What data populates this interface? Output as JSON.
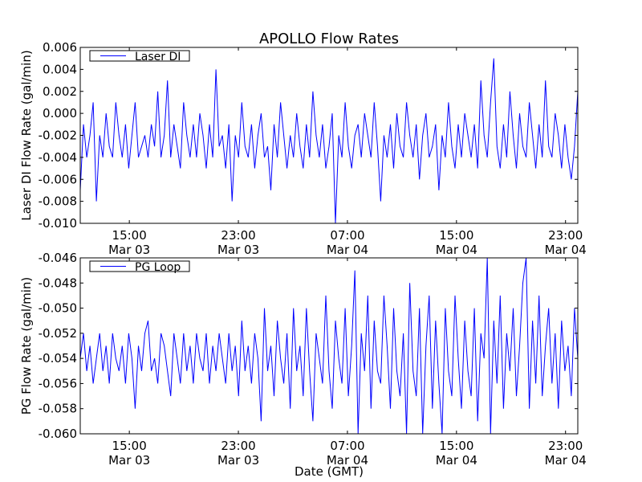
{
  "chart_data": [
    {
      "type": "line",
      "title": "APOLLO Flow Rates",
      "xlabel": "",
      "ylabel": "Laser DI Flow Rate (gal/min)",
      "ylim": [
        -0.01,
        0.006
      ],
      "yticks": [
        0.006,
        0.004,
        0.002,
        0.0,
        -0.002,
        -0.004,
        -0.006,
        -0.008,
        -0.01
      ],
      "ytick_labels": [
        "0.006",
        "0.004",
        "0.002",
        "0.000",
        "-0.002",
        "-0.004",
        "-0.006",
        "-0.008",
        "-0.010"
      ],
      "xlim_hours": [
        11.4,
        47.9
      ],
      "xticks_hours": [
        15,
        23,
        31,
        39,
        47
      ],
      "xtick_labels": [
        [
          "15:00",
          "Mar 03"
        ],
        [
          "23:00",
          "Mar 03"
        ],
        [
          "07:00",
          "Mar 04"
        ],
        [
          "15:00",
          "Mar 04"
        ],
        [
          "23:00",
          "Mar 04"
        ]
      ],
      "legend": {
        "label": "Laser DI",
        "placement": "top-left"
      },
      "series": [
        {
          "name": "Laser DI",
          "color": "#0000ff",
          "x_start_hours": 11.4,
          "x_step_hours": 0.237,
          "value_scale": 0.001,
          "values": [
            -7,
            -1,
            -4,
            -2,
            1,
            -8,
            -2,
            -4,
            0,
            -3,
            -4,
            1,
            -2,
            -4,
            -1,
            -5,
            -2,
            1,
            -4,
            -3,
            -2,
            -4,
            -1,
            -3,
            2,
            -4,
            -2,
            3,
            -4,
            -1,
            -3,
            -5,
            1,
            -2,
            -4,
            -1,
            -4,
            0,
            -2,
            -5,
            -1,
            -4,
            4,
            -3,
            -2,
            -5,
            -1,
            -8,
            -2,
            -4,
            1,
            -3,
            -4,
            -1,
            -5,
            -2,
            0,
            -4,
            -3,
            -7,
            -1,
            -4,
            1,
            -2,
            -5,
            -2,
            -4,
            0,
            -3,
            -5,
            -1,
            -4,
            2,
            -2,
            -4,
            -1,
            -5,
            -3,
            0,
            -10,
            -2,
            -4,
            1,
            -3,
            -5,
            -2,
            -1,
            -4,
            0,
            -2,
            -4,
            1,
            -3,
            -8,
            -2,
            -4,
            -1,
            -5,
            0,
            -3,
            -4,
            1,
            -2,
            -4,
            -1,
            -6,
            -2,
            0,
            -4,
            -3,
            -1,
            -7,
            -2,
            -4,
            1,
            -3,
            -5,
            -1,
            -4,
            0,
            -2,
            -4,
            -1,
            -5,
            3,
            -2,
            -4,
            1,
            5,
            -3,
            -5,
            -1,
            -4,
            2,
            -2,
            -5,
            0,
            -3,
            -4,
            1,
            -2,
            -5,
            -1,
            -4,
            3,
            -3,
            -4,
            0,
            -2,
            -5,
            -1,
            -4,
            -6,
            -3,
            2
          ]
        }
      ]
    },
    {
      "type": "line",
      "title": "",
      "xlabel": "Date (GMT)",
      "ylabel": "PG Flow Rate (gal/min)",
      "ylim": [
        -0.06,
        -0.046
      ],
      "yticks": [
        -0.046,
        -0.048,
        -0.05,
        -0.052,
        -0.054,
        -0.056,
        -0.058,
        -0.06
      ],
      "ytick_labels": [
        "-0.046",
        "-0.048",
        "-0.050",
        "-0.052",
        "-0.054",
        "-0.056",
        "-0.058",
        "-0.060"
      ],
      "xlim_hours": [
        11.4,
        47.9
      ],
      "xticks_hours": [
        15,
        23,
        31,
        39,
        47
      ],
      "xtick_labels": [
        [
          "15:00",
          "Mar 03"
        ],
        [
          "23:00",
          "Mar 03"
        ],
        [
          "07:00",
          "Mar 04"
        ],
        [
          "15:00",
          "Mar 04"
        ],
        [
          "23:00",
          "Mar 04"
        ]
      ],
      "legend": {
        "label": "PG Loop",
        "placement": "top-left"
      },
      "series": [
        {
          "name": "PG Loop",
          "color": "#0000ff",
          "x_start_hours": 11.4,
          "x_step_hours": 0.237,
          "value_scale": 0.001,
          "values": [
            -54,
            -52,
            -55,
            -53,
            -56,
            -54,
            -52,
            -55,
            -53,
            -56,
            -52,
            -54,
            -55,
            -53,
            -56,
            -52,
            -54,
            -58,
            -53,
            -55,
            -52,
            -51,
            -55,
            -54,
            -56,
            -52,
            -53,
            -55,
            -57,
            -52,
            -54,
            -56,
            -52,
            -55,
            -53,
            -56,
            -52,
            -54,
            -55,
            -52,
            -56,
            -53,
            -55,
            -52,
            -54,
            -56,
            -52,
            -55,
            -53,
            -57,
            -51,
            -55,
            -53,
            -56,
            -52,
            -54,
            -59,
            -50,
            -55,
            -53,
            -57,
            -51,
            -54,
            -56,
            -52,
            -58,
            -50,
            -55,
            -53,
            -57,
            -50,
            -55,
            -59,
            -52,
            -54,
            -56,
            -49,
            -55,
            -58,
            -51,
            -54,
            -56,
            -50,
            -57,
            -53,
            -47,
            -60,
            -52,
            -55,
            -49,
            -58,
            -51,
            -55,
            -56,
            -49,
            -53,
            -58,
            -50,
            -55,
            -57,
            -52,
            -60,
            -48,
            -55,
            -57,
            -50,
            -60,
            -53,
            -49,
            -58,
            -51,
            -56,
            -60,
            -50,
            -55,
            -57,
            -49,
            -54,
            -58,
            -51,
            -55,
            -57,
            -50,
            -59,
            -52,
            -54,
            -46,
            -60,
            -51,
            -56,
            -49,
            -58,
            -52,
            -55,
            -50,
            -57,
            -53,
            -48,
            -46,
            -58,
            -51,
            -56,
            -49,
            -57,
            -53,
            -50,
            -56,
            -52,
            -58,
            -51,
            -55,
            -53,
            -57,
            -50,
            -54
          ]
        }
      ]
    }
  ]
}
